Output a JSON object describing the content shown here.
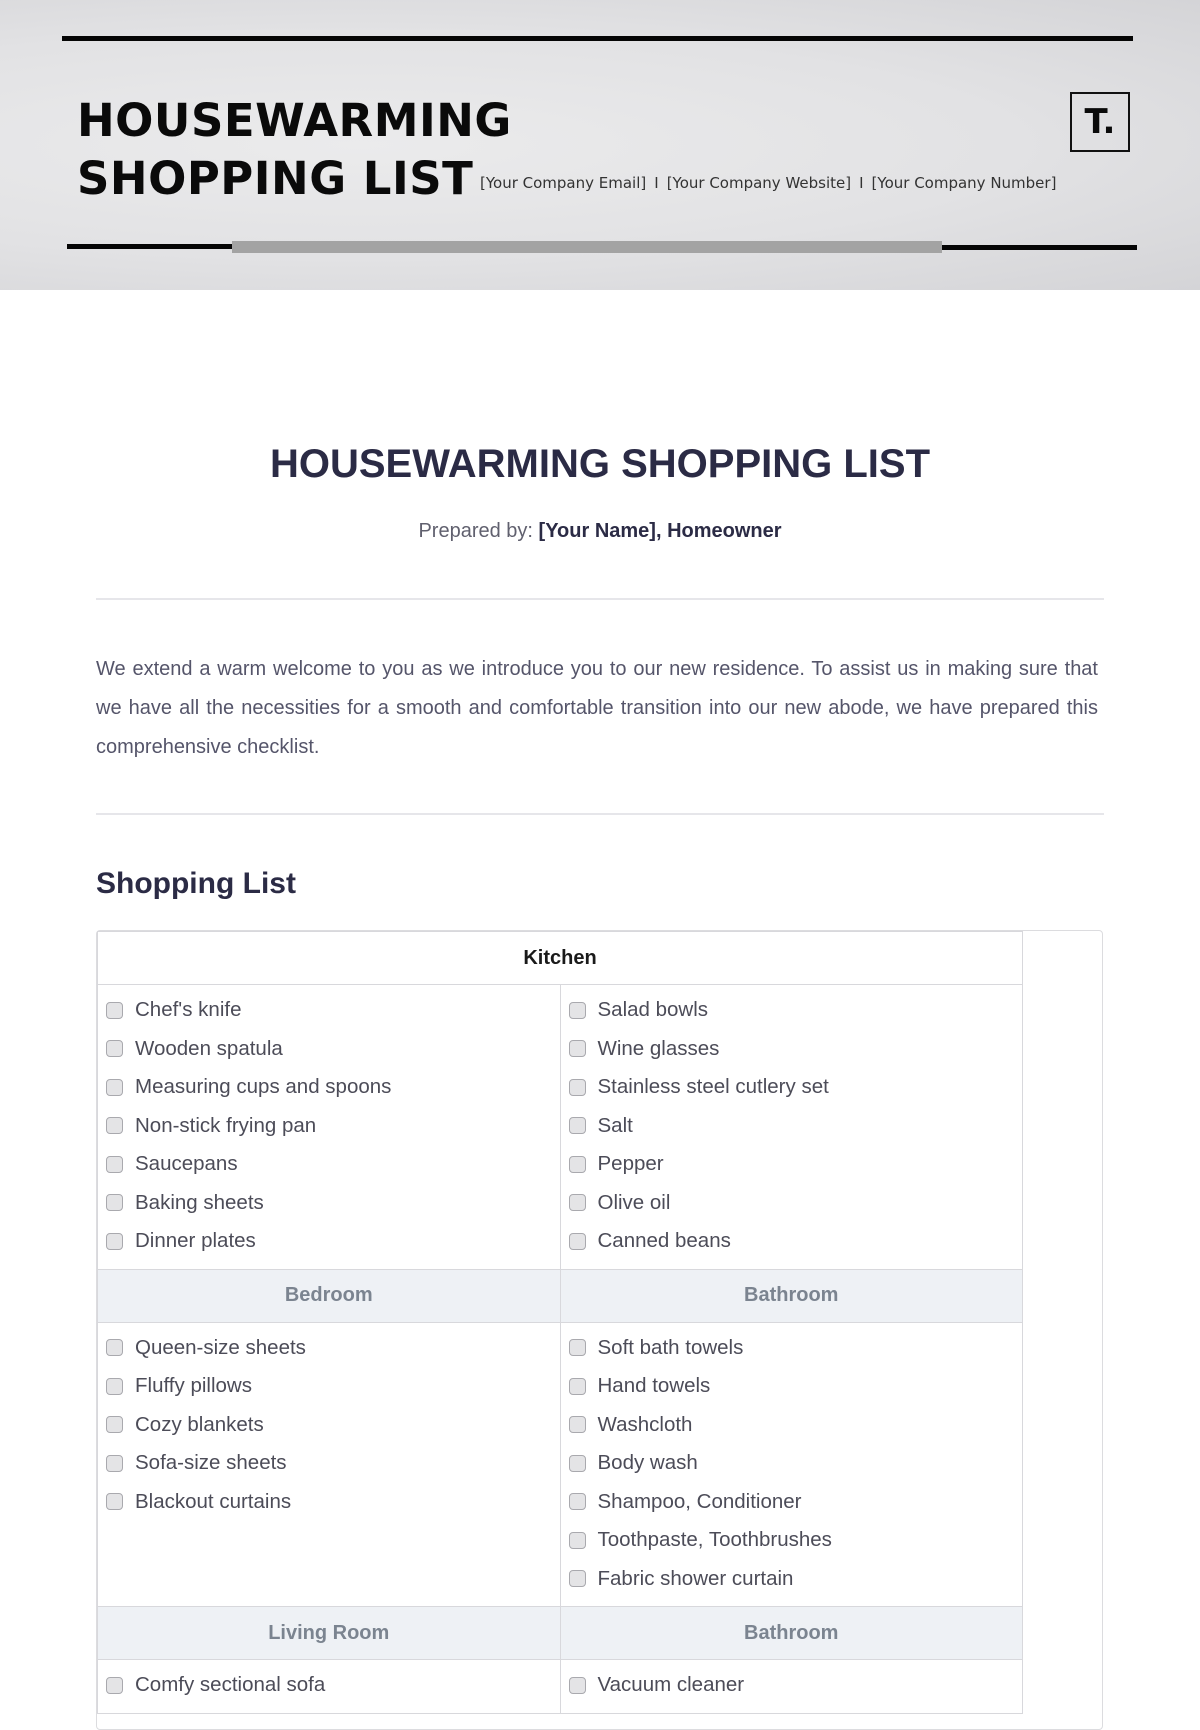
{
  "banner": {
    "title_line1": "HOUSEWARMING",
    "title_line2": "SHOPPING LIST",
    "contact_email": "[Your Company Email]",
    "contact_website": "[Your Company Website]",
    "contact_number": "[Your Company Number]",
    "separator": "I",
    "logo_text": "T."
  },
  "document": {
    "title": "HOUSEWARMING SHOPPING LIST",
    "prepared_label": "Prepared by:",
    "prepared_name": "[Your Name], Homeowner",
    "intro": "We extend a warm welcome to you as we introduce you to our new residence. To assist us in making sure that we have all the necessities for a smooth and comfortable transition into our new abode, we have prepared this comprehensive checklist.",
    "section_title": "Shopping List"
  },
  "shopping_list": {
    "kitchen": {
      "header": "Kitchen",
      "left": [
        "Chef's knife",
        "Wooden spatula",
        "Measuring cups and spoons",
        "Non-stick frying pan",
        "Saucepans",
        "Baking sheets",
        "Dinner plates"
      ],
      "right": [
        "Salad bowls",
        "Wine glasses",
        "Stainless steel cutlery set",
        "Salt",
        "Pepper",
        "Olive oil",
        "Canned beans"
      ]
    },
    "row2": {
      "left_header": "Bedroom",
      "right_header": "Bathroom",
      "left": [
        "Queen-size sheets",
        "Fluffy pillows",
        "Cozy blankets",
        "Sofa-size sheets",
        "Blackout curtains"
      ],
      "right": [
        "Soft bath towels",
        "Hand towels",
        "Washcloth",
        "Body wash",
        "Shampoo, Conditioner",
        "Toothpaste, Toothbrushes",
        "Fabric shower curtain"
      ]
    },
    "row3": {
      "left_header": "Living Room",
      "right_header": "Bathroom",
      "left": [
        "Comfy sectional sofa"
      ],
      "right": [
        "Vacuum cleaner"
      ]
    }
  }
}
